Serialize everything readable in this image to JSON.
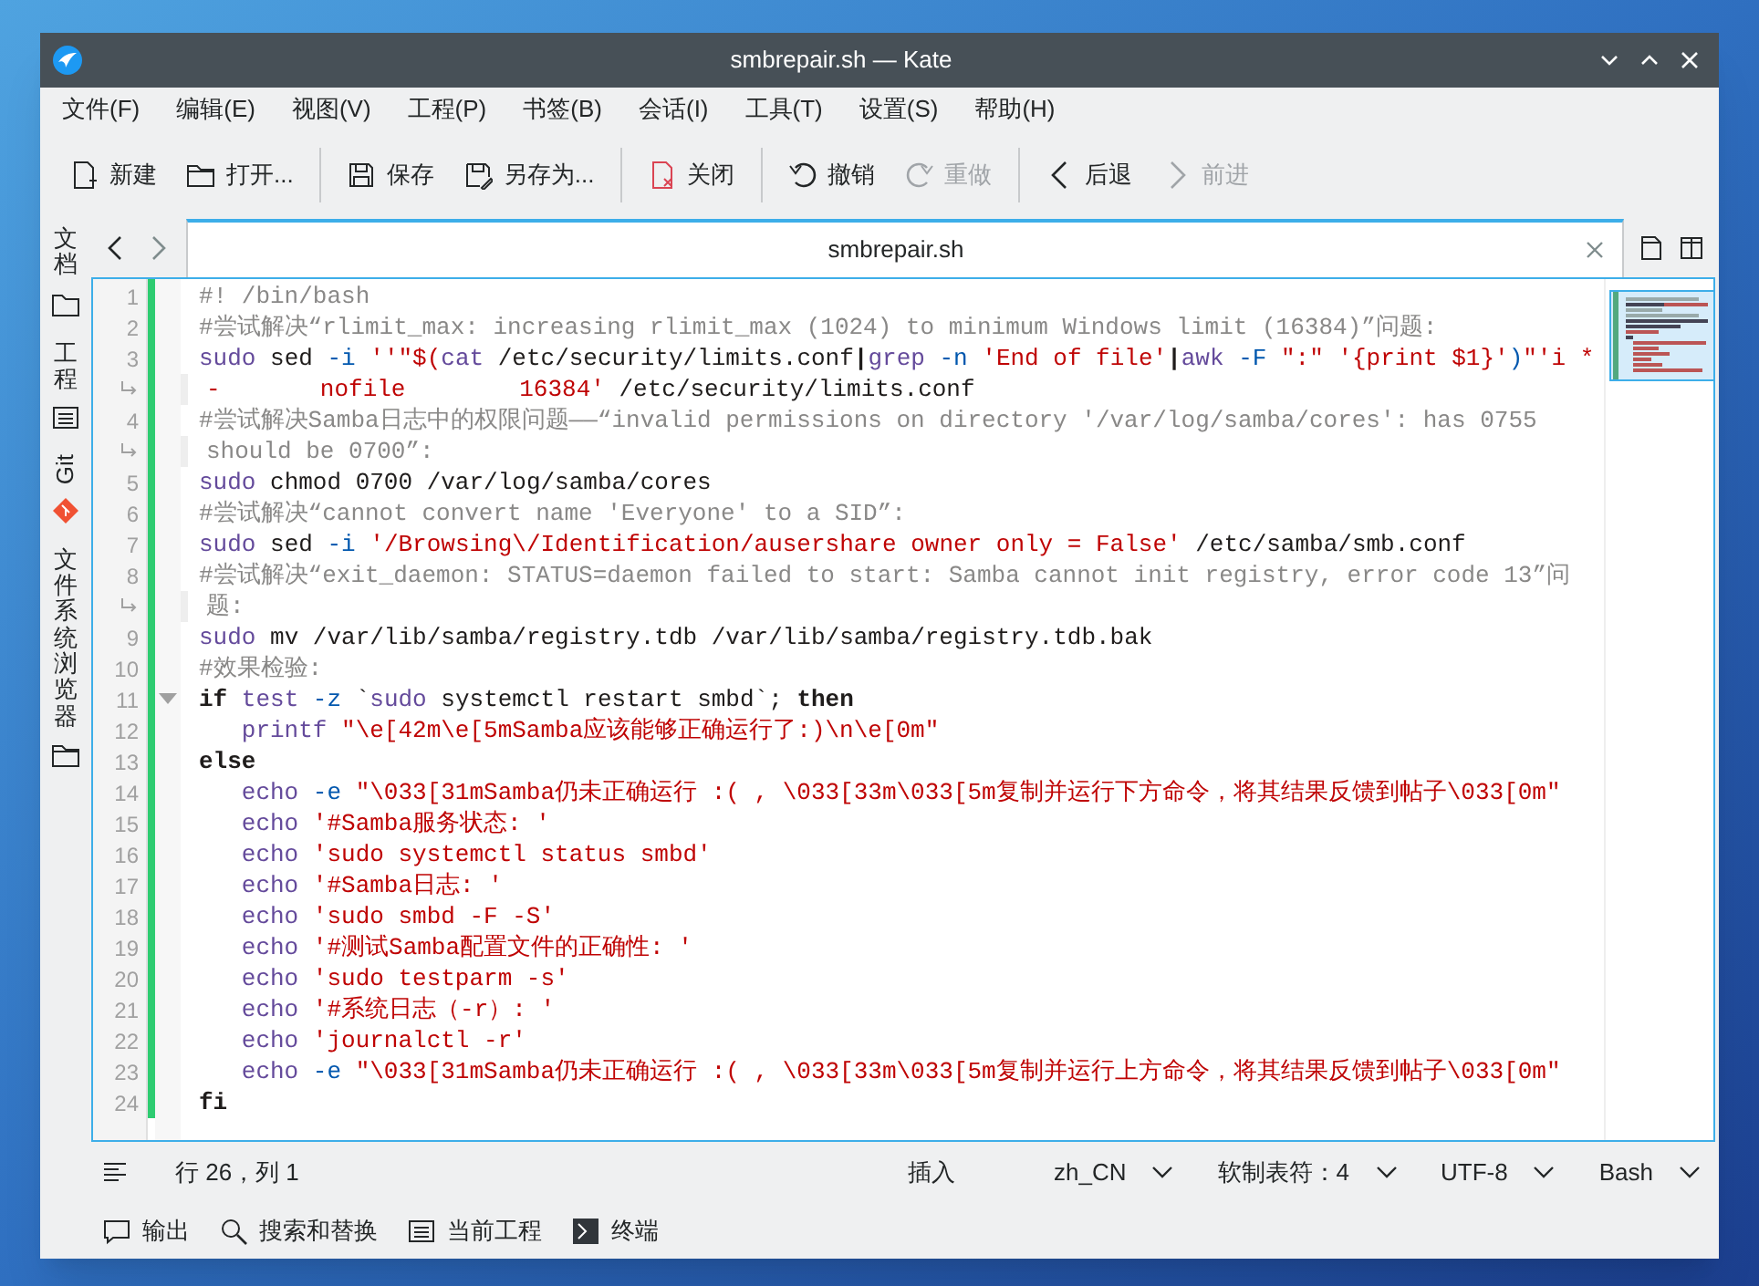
{
  "window": {
    "title": "smbrepair.sh — Kate"
  },
  "menu": [
    "文件(F)",
    "编辑(E)",
    "视图(V)",
    "工程(P)",
    "书签(B)",
    "会话(I)",
    "工具(T)",
    "设置(S)",
    "帮助(H)"
  ],
  "toolbar": [
    [
      {
        "kind": "new",
        "label": "新建",
        "disabled": false
      },
      {
        "kind": "open",
        "label": "打开...",
        "disabled": false
      }
    ],
    [
      {
        "kind": "save",
        "label": "保存",
        "disabled": false
      },
      {
        "kind": "saveas",
        "label": "另存为...",
        "disabled": false
      }
    ],
    [
      {
        "kind": "close",
        "label": "关闭",
        "disabled": false
      }
    ],
    [
      {
        "kind": "undo",
        "label": "撤销",
        "disabled": false
      },
      {
        "kind": "redo",
        "label": "重做",
        "disabled": true
      }
    ],
    [
      {
        "kind": "back",
        "label": "后退",
        "disabled": false
      },
      {
        "kind": "forward",
        "label": "前进",
        "disabled": true
      }
    ]
  ],
  "sidebar": [
    {
      "label": "文档",
      "kind": "doc"
    },
    {
      "label": "工程",
      "kind": "list"
    },
    {
      "label": "Git",
      "kind": "git"
    },
    {
      "label": "文件系统浏览器",
      "kind": "folder"
    }
  ],
  "tabs": [
    {
      "label": "smbrepair.sh",
      "selected": true
    }
  ],
  "editor": {
    "rows": [
      {
        "kind": "line",
        "number": "1",
        "tokens": [
          {
            "kind": "comment",
            "text": "#! /bin/bash"
          }
        ]
      },
      {
        "kind": "line",
        "number": "2",
        "tokens": [
          {
            "kind": "comment",
            "text": "#尝试解决“rlimit_max: increasing rlimit_max (1024) to minimum Windows limit (16384)”问题:"
          }
        ]
      },
      {
        "kind": "line",
        "number": "3",
        "tokens": [
          {
            "kind": "builtin",
            "text": "sudo"
          },
          {
            "kind": "normal",
            "text": " sed"
          },
          {
            "kind": "option",
            "text": " -i"
          },
          {
            "kind": "string",
            "text": " ''\"$("
          },
          {
            "kind": "builtin",
            "text": "cat"
          },
          {
            "kind": "normal",
            "text": " /etc/security/limits.conf"
          },
          {
            "kind": "operator",
            "text": "|"
          },
          {
            "kind": "builtin",
            "text": "grep"
          },
          {
            "kind": "option",
            "text": " -n"
          },
          {
            "kind": "string",
            "text": " 'End of file'"
          },
          {
            "kind": "operator",
            "text": "|"
          },
          {
            "kind": "builtin",
            "text": "awk"
          },
          {
            "kind": "option",
            "text": " -F"
          },
          {
            "kind": "string",
            "text": " \":\" '{print $1}'"
          },
          {
            "kind": "option",
            "text": ")"
          },
          {
            "kind": "string",
            "text": "\"'i *"
          }
        ]
      },
      {
        "kind": "wrap",
        "tokens": [
          {
            "kind": "string",
            "text": "-       nofile        16384'"
          },
          {
            "kind": "normal",
            "text": " /etc/security/limits.conf"
          }
        ]
      },
      {
        "kind": "line",
        "number": "4",
        "tokens": [
          {
            "kind": "comment",
            "text": "#尝试解决Samba日志中的权限问题——“invalid permissions on directory '/var/log/samba/cores': has 0755"
          }
        ]
      },
      {
        "kind": "wrap",
        "tokens": [
          {
            "kind": "comment",
            "text": "should be 0700”:"
          }
        ]
      },
      {
        "kind": "line",
        "number": "5",
        "tokens": [
          {
            "kind": "builtin",
            "text": "sudo"
          },
          {
            "kind": "normal",
            "text": " chmod 0700 /var/log/samba/cores"
          }
        ]
      },
      {
        "kind": "line",
        "number": "6",
        "tokens": [
          {
            "kind": "comment",
            "text": "#尝试解决“cannot convert name 'Everyone' to a SID”:"
          }
        ]
      },
      {
        "kind": "line",
        "number": "7",
        "tokens": [
          {
            "kind": "builtin",
            "text": "sudo"
          },
          {
            "kind": "normal",
            "text": " sed"
          },
          {
            "kind": "option",
            "text": " -i"
          },
          {
            "kind": "string",
            "text": " '/Browsing\\/Identification/ausershare owner only = False'"
          },
          {
            "kind": "normal",
            "text": " /etc/samba/smb.conf"
          }
        ]
      },
      {
        "kind": "line",
        "number": "8",
        "tokens": [
          {
            "kind": "comment",
            "text": "#尝试解决“exit_daemon: STATUS=daemon failed to start: Samba cannot init registry, error code 13”问"
          }
        ]
      },
      {
        "kind": "wrap",
        "tokens": [
          {
            "kind": "comment",
            "text": "题:"
          }
        ]
      },
      {
        "kind": "line",
        "number": "9",
        "tokens": [
          {
            "kind": "builtin",
            "text": "sudo"
          },
          {
            "kind": "normal",
            "text": " mv /var/lib/samba/registry.tdb /var/lib/samba/registry.tdb.bak"
          }
        ]
      },
      {
        "kind": "line",
        "number": "10",
        "tokens": [
          {
            "kind": "comment",
            "text": "#效果检验:"
          }
        ]
      },
      {
        "kind": "line",
        "number": "11",
        "tokens": [
          {
            "kind": "keyword",
            "text": "if"
          },
          {
            "kind": "builtin",
            "text": " test"
          },
          {
            "kind": "option",
            "text": " -z"
          },
          {
            "kind": "normal",
            "text": " `"
          },
          {
            "kind": "builtin",
            "text": "sudo"
          },
          {
            "kind": "normal",
            "text": " systemctl restart smbd`;"
          },
          {
            "kind": "keyword",
            "text": " then"
          }
        ]
      },
      {
        "kind": "line",
        "number": "12",
        "tokens": [
          {
            "kind": "builtin",
            "text": "   printf"
          },
          {
            "kind": "string",
            "text": " \"\\e[42m\\e[5mSamba应该能够正确运行了:)\\n\\e[0m\""
          }
        ]
      },
      {
        "kind": "line",
        "number": "13",
        "tokens": [
          {
            "kind": "keyword",
            "text": "else"
          }
        ]
      },
      {
        "kind": "line",
        "number": "14",
        "tokens": [
          {
            "kind": "builtin",
            "text": "   echo"
          },
          {
            "kind": "option",
            "text": " -e"
          },
          {
            "kind": "string",
            "text": " \"\\033[31mSamba仍未正确运行 :( , \\033[33m\\033[5m复制并运行下方命令，将其结果反馈到帖子\\033[0m\""
          }
        ]
      },
      {
        "kind": "line",
        "number": "15",
        "tokens": [
          {
            "kind": "builtin",
            "text": "   echo"
          },
          {
            "kind": "string",
            "text": " '#Samba服务状态: '"
          }
        ]
      },
      {
        "kind": "line",
        "number": "16",
        "tokens": [
          {
            "kind": "builtin",
            "text": "   echo"
          },
          {
            "kind": "string",
            "text": " 'sudo systemctl status smbd'"
          }
        ]
      },
      {
        "kind": "line",
        "number": "17",
        "tokens": [
          {
            "kind": "builtin",
            "text": "   echo"
          },
          {
            "kind": "string",
            "text": " '#Samba日志: '"
          }
        ]
      },
      {
        "kind": "line",
        "number": "18",
        "tokens": [
          {
            "kind": "builtin",
            "text": "   echo"
          },
          {
            "kind": "string",
            "text": " 'sudo smbd -F -S'"
          }
        ]
      },
      {
        "kind": "line",
        "number": "19",
        "tokens": [
          {
            "kind": "builtin",
            "text": "   echo"
          },
          {
            "kind": "string",
            "text": " '#测试Samba配置文件的正确性: '"
          }
        ]
      },
      {
        "kind": "line",
        "number": "20",
        "tokens": [
          {
            "kind": "builtin",
            "text": "   echo"
          },
          {
            "kind": "string",
            "text": " 'sudo testparm -s'"
          }
        ]
      },
      {
        "kind": "line",
        "number": "21",
        "tokens": [
          {
            "kind": "builtin",
            "text": "   echo"
          },
          {
            "kind": "string",
            "text": " '#系统日志（-r）: '"
          }
        ]
      },
      {
        "kind": "line",
        "number": "22",
        "tokens": [
          {
            "kind": "builtin",
            "text": "   echo"
          },
          {
            "kind": "string",
            "text": " 'journalctl -r'"
          }
        ]
      },
      {
        "kind": "line",
        "number": "23",
        "tokens": [
          {
            "kind": "builtin",
            "text": "   echo"
          },
          {
            "kind": "option",
            "text": " -e"
          },
          {
            "kind": "string",
            "text": " \"\\033[31mSamba仍未正确运行 :( , \\033[33m\\033[5m复制并运行上方命令，将其结果反馈到帖子\\033[0m\""
          }
        ]
      },
      {
        "kind": "line",
        "number": "24",
        "tokens": [
          {
            "kind": "keyword",
            "text": "fi"
          }
        ]
      }
    ]
  },
  "status_bar": {
    "position": "行 26，列 1",
    "mode": "插入",
    "items": [
      "zh_CN",
      "软制表符：4",
      "UTF-8",
      "Bash"
    ]
  },
  "tool_views": [
    {
      "kind": "output",
      "label": "输出"
    },
    {
      "kind": "search",
      "label": "搜索和替换"
    },
    {
      "kind": "list",
      "label": "当前工程"
    },
    {
      "kind": "terminal",
      "label": "终端"
    }
  ]
}
